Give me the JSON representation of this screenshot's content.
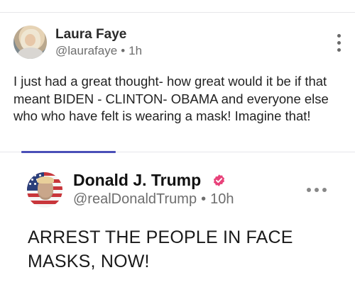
{
  "post": {
    "author_name": "Laura Faye",
    "handle": "@laurafaye",
    "separator": "•",
    "time": "1h",
    "body": "I just had a great thought- how great would it be if that meant BIDEN - CLINTON- OBAMA and everyone else who who have felt is wearing a mask! Imagine that!",
    "more_icon": "vertical-ellipsis-icon"
  },
  "quoted_post": {
    "author_name": "Donald J. Trump",
    "handle": "@realDonaldTrump",
    "separator": "•",
    "time": "10h",
    "body": "ARREST THE PEOPLE IN FACE MASKS, NOW!",
    "verified_icon": "verified-badge-icon",
    "more_icon": "horizontal-ellipsis-icon"
  },
  "colors": {
    "accent": "#4a4fb8",
    "verified": "#e8427a",
    "muted_text": "#6e6e6e"
  }
}
